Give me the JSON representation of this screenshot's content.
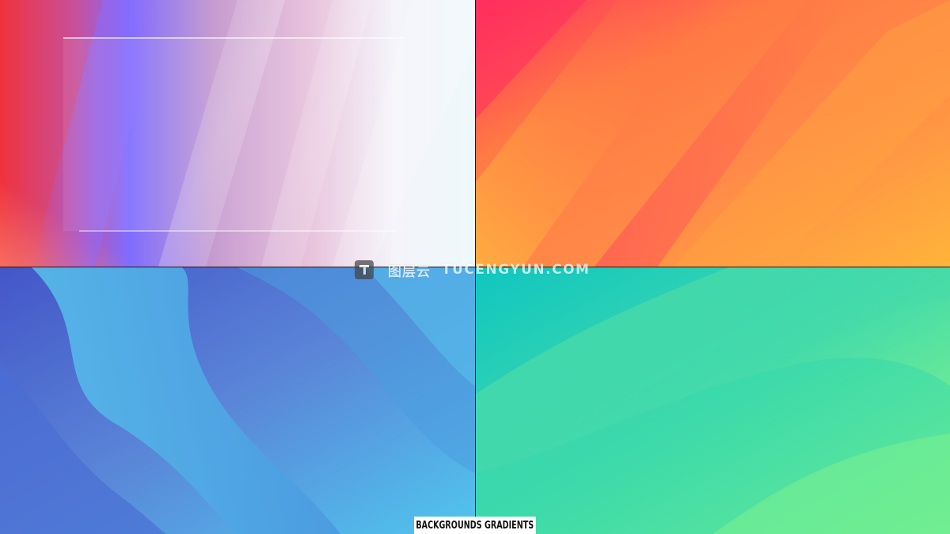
{
  "panels": [
    {
      "id": "top-left",
      "theme": "pastel-prism",
      "colors": [
        "#f0303a",
        "#7b6cff",
        "#d9a0c8",
        "#f5fbff"
      ]
    },
    {
      "id": "top-right",
      "theme": "sunset-orange",
      "colors": [
        "#ff3060",
        "#ff8a40",
        "#ffa840",
        "#ff6848"
      ]
    },
    {
      "id": "bottom-left",
      "theme": "ocean-blue",
      "colors": [
        "#4a5fd0",
        "#4fb6e8",
        "#5a8fd8",
        "#50c8ee"
      ]
    },
    {
      "id": "bottom-right",
      "theme": "mint-green",
      "colors": [
        "#12c9c0",
        "#4ee0a8",
        "#8ef888",
        "#22d0b4"
      ]
    }
  ],
  "watermark": {
    "icon": "logo-t-icon",
    "cn_text": "图层云",
    "en_text": "TUCENGYUN.COM"
  },
  "caption": {
    "text": "BACKGROUNDS GRADIENTS"
  }
}
